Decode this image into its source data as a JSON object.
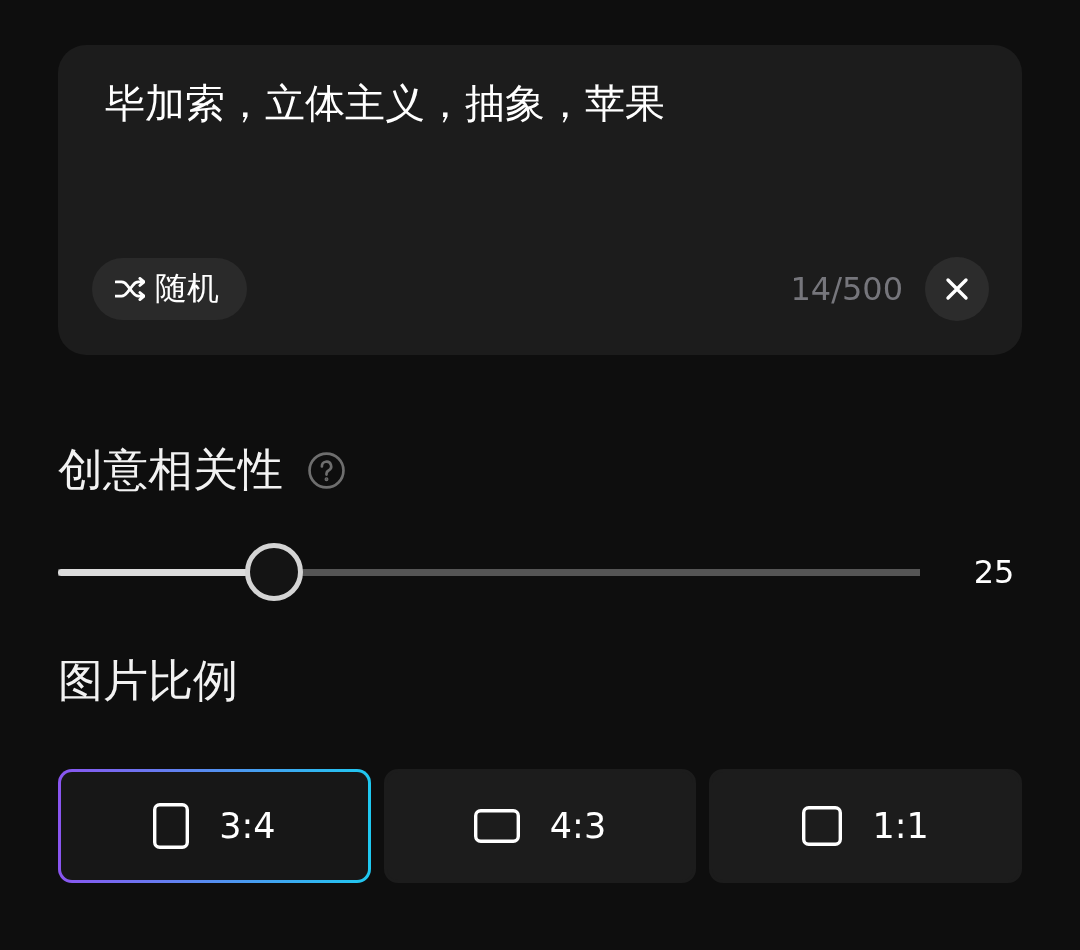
{
  "prompt": {
    "value": "毕加索，立体主义，抽象，苹果",
    "random_button": "随机",
    "counter": "14/500"
  },
  "creativity": {
    "label": "创意相关性",
    "level": 0.25,
    "reading": "25"
  },
  "aspect_ratio": {
    "label": "图片比例",
    "options": [
      {
        "label": "3:4",
        "kind": "portrait",
        "selected": true
      },
      {
        "label": "4:3",
        "kind": "landscape",
        "selected": false
      },
      {
        "label": "1:1",
        "kind": "square",
        "selected": false
      }
    ]
  }
}
